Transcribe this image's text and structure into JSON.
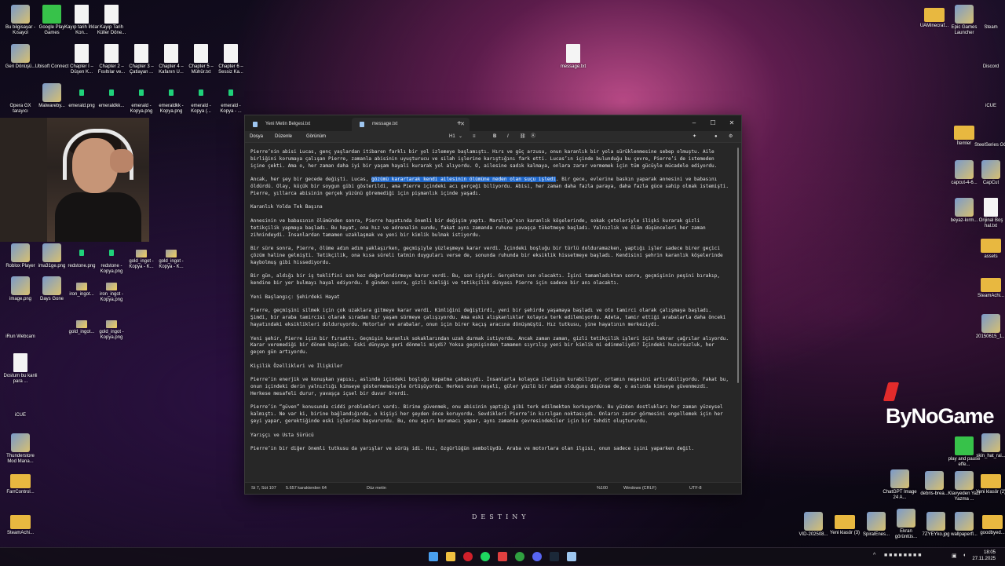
{
  "desktop": {
    "icons_left": [
      {
        "label": "Bu bilgisayar - Kısayol",
        "kind": "img"
      },
      {
        "label": "Google Play Games",
        "kind": "green"
      },
      {
        "label": "Kayıp tarih İrklar Kon...",
        "kind": "file"
      },
      {
        "label": "Kayıp Tarih Küller Döne...",
        "kind": "file"
      },
      {
        "label": "Geri Dönüşü...",
        "kind": "img"
      },
      {
        "label": "Ubisoft Connect",
        "kind": "round"
      },
      {
        "label": "Chapter I – Düşen K...",
        "kind": "file"
      },
      {
        "label": "Chapter 2 – Fısıltılar ve...",
        "kind": "file"
      },
      {
        "label": "Chapter 3 – Çatlayan ...",
        "kind": "file"
      },
      {
        "label": "Chapter 4 – Kafanın U...",
        "kind": "file"
      },
      {
        "label": "Chapter 5 – Mühür.txt",
        "kind": "file"
      },
      {
        "label": "Chapter 6 – Sessiz Ka...",
        "kind": "file"
      },
      {
        "label": "Opera GX tarayıcı",
        "kind": "round"
      },
      {
        "label": "Malwareby...",
        "kind": "img"
      },
      {
        "label": "emerald.png",
        "kind": "emerald"
      },
      {
        "label": "emeraldkk...",
        "kind": "emerald"
      },
      {
        "label": "emerald - Kopya.png",
        "kind": "emerald"
      },
      {
        "label": "emeraldkk - Kopya.png",
        "kind": "emerald"
      },
      {
        "label": "emerald - Kopya (...",
        "kind": "emerald"
      },
      {
        "label": "emerald - Kopya - ...",
        "kind": "emerald"
      },
      {
        "label": "Roblox Player",
        "kind": "img"
      },
      {
        "label": "ima31ge.png",
        "kind": "img"
      },
      {
        "label": "redstone.png",
        "kind": "emerald"
      },
      {
        "label": "redstone - Kopya.png",
        "kind": "emerald"
      },
      {
        "label": "gold_ingot - Kopya - K...",
        "kind": "gold"
      },
      {
        "label": "gold_ingot - Kopya - K...",
        "kind": "gold"
      },
      {
        "label": "image.png",
        "kind": "img"
      },
      {
        "label": "Days Gone",
        "kind": "img"
      },
      {
        "label": "iron_ingot...",
        "kind": "gold"
      },
      {
        "label": "iron_ingot - Kopya.png",
        "kind": "gold"
      },
      {
        "label": "iRun Webcam",
        "kind": "round"
      },
      {
        "label": "gold_ingot...",
        "kind": "gold"
      },
      {
        "label": "gold_ingot - Kopya.png",
        "kind": "gold"
      },
      {
        "label": "Dostum bu kanli para ...",
        "kind": "file"
      },
      {
        "label": "iCUE",
        "kind": "round"
      },
      {
        "label": "Thunderstore Mod Mana...",
        "kind": "img"
      },
      {
        "label": "FarrControl...",
        "kind": "folder"
      },
      {
        "label": "SteamAchi...",
        "kind": "folder"
      }
    ],
    "icons_right": [
      {
        "label": "UAMinecraf...",
        "kind": "folder"
      },
      {
        "label": "Epic Games Launcher",
        "kind": "img"
      },
      {
        "label": "Steam",
        "kind": "round"
      },
      {
        "label": "Discord",
        "kind": "round"
      },
      {
        "label": "iCUE",
        "kind": "round"
      },
      {
        "label": "İtemler",
        "kind": "folder"
      },
      {
        "label": "SteelSeries GG",
        "kind": "round"
      },
      {
        "label": "capcut-4-6...",
        "kind": "img"
      },
      {
        "label": "CapCut",
        "kind": "img"
      },
      {
        "label": "beyaz-kırm...",
        "kind": "img"
      },
      {
        "label": "Orijinal Boş hal.txt",
        "kind": "file"
      },
      {
        "label": "assets",
        "kind": "folder"
      },
      {
        "label": "SteamAchi...",
        "kind": "folder"
      },
      {
        "label": "20150615_1...",
        "kind": "img"
      },
      {
        "label": "play and pause effe...",
        "kind": "green"
      },
      {
        "label": "skin_hat_rai...",
        "kind": "img"
      },
      {
        "label": "ChatGPT Image 24 A...",
        "kind": "img"
      },
      {
        "label": "debris-brea...",
        "kind": "img"
      },
      {
        "label": "Klavyeden Yazı Yazma ...",
        "kind": "img"
      },
      {
        "label": "Yeni klasör (2)",
        "kind": "folder"
      },
      {
        "label": "VID-202508...",
        "kind": "img"
      },
      {
        "label": "Yeni klasör (3)",
        "kind": "folder"
      },
      {
        "label": "SpiralEnes...",
        "kind": "img"
      },
      {
        "label": "Ekran görüntüs...",
        "kind": "img"
      },
      {
        "label": "7ZYEYko.jpg",
        "kind": "img"
      },
      {
        "label": "wallpaperfl...",
        "kind": "img"
      },
      {
        "label": "goodbyed...",
        "kind": "folder"
      }
    ],
    "message_icon": {
      "label": "message.txt"
    },
    "brand": "ByNoGame",
    "wallpaper_text": "DESTINY"
  },
  "editor": {
    "tabs": [
      {
        "label": "Yeni Metin Belgesi.txt",
        "active": false
      },
      {
        "label": "message.txt",
        "active": true
      }
    ],
    "menus": [
      "Dosya",
      "Düzenle",
      "Görünüm"
    ],
    "heading_selector": "H1",
    "paragraphs": [
      "Pierre’nin abisi Lucas, genç yaşlardan itibaren farklı bir yol izlemeye başlamıştı. Hırs ve güç arzusu, onun karanlık bir yola sürüklenmesine sebep olmuştu. Aile birliğini korumaya çalışan Pierre, zamanla abisinin uyuşturucu ve silah işlerine karıştığını fark etti. Lucas’ın içinde bulunduğu bu çevre, Pierre’i de istemeden içine çekti. Ama o, her zaman daha iyi bir yaşam hayali kurarak yol alıyordu. O, ailesine sadık kalmaya, onlara zarar vermemek için tüm gücüyle mücadele ediyordu.",
      "Karanlık Yolda Tek Başına",
      "Annesinin ve babasının ölümünden sonra, Pierre hayatında önemli bir değişim yaptı. Marsilya’nın karanlık köşelerinde, sokak çeteleriyle ilişki kurarak gizli tetikçilik yapmaya başladı. Bu hayat, ona hız ve adrenalin sundu, fakat aynı zamanda ruhunu yavaşça tüketmeye başladı. Yalnızlık ve ölüm düşünceleri her zaman zihnindeydi. İnsanlardan tamamen uzaklaşmak ve yeni bir kimlik bulmak istiyordu.",
      "Bir süre sonra, Pierre, ölüme adım adım yaklaşırken, geçmişiyle yüzleşmeye karar verdi. İçindeki boşluğu bir türlü dolduramazken, yaptığı işler sadece birer geçici çözüm haline gelmişti. Tetikçilik, ona kısa süreli tatmin duyguları verse de, sonunda ruhunda bir eksiklik hissetmeye başladı. Kendisini şehrin karanlık köşelerinde kaybolmuş gibi hissediyordu.",
      "Bir gün, aldığı bir iş teklifini son kez değerlendirmeye karar verdi. Bu, son işiydi. Gerçekten son olacaktı. İşini tamamladıktan sonra, geçmişinin peşini bırakıp, kendine bir yer bulmayı hayal ediyordu. O günden sonra, gizli kimliği ve tetikçilik dünyası Pierre için sadece bir anı olacaktı.",
      " Yeni Başlangıç: Şehirdeki Hayat",
      "Pierre, geçmişini silmek için çok uzaklara gitmeye karar verdi. Kimliğini değiştirdi, yeni bir şehirde yaşamaya başladı ve oto tamirci olarak çalışmaya başladı. Şimdi, bir araba tamircisi olarak sıradan bir yaşam sürmeye çalışıyordu. Ama eski alışkanlıklar kolayca terk edilemiyordu. Adeta, tamir ettiği arabalarla daha önceki hayatındaki eksiklikleri dolduruyordu. Motorlar ve arabalar, onun için birer kaçış aracına dönüşmüştü. Hız tutkusu, yine hayatının merkeziydi.",
      "Yeni şehir, Pierre için bir fırsattı. Geçmişin karanlık sokaklarından uzak durmak istiyordu. Ancak zaman zaman, gizli tetikçilik işleri için tekrar çağrılar alıyordu. Karar veremediği bir dönem başladı. Eski dünyaya geri dönmeli miydi? Yoksa geçmişinden tamamen sıyrılıp yeni bir kimlik mi edinmeliydi? İçindeki huzursuzluk, her geçen gün artıyordu.",
      " Kişilik Özellikleri ve İlişkiler",
      "Pierre’in enerjik ve konuşkan yapısı, aslında içindeki boşluğu kapatma çabasıydı. İnsanlarla kolayca iletişim kurabiliyor, ortamın neşesini artırabiliyordu. Fakat bu, onun içindeki derin yalnızlığı kimseye göstermemesiyle örtüşüyordu. Herkes onun neşeli, güler yüzlü bir adam olduğunu düşünse de, o aslında kimseye güvenmezdi. Herkese mesafeli durur, yavaşça içsel bir duvar örerdi.",
      "Pierre’in “güven” konusunda ciddi problemleri vardı. Birine güvenmek, onu abisinin yaptığı gibi terk edilmekten korkuyordu. Bu yüzden dostlukları her zaman yüzeysel kalmıştı. Ne var ki, birine bağlandığında, o kişiyi her şeyden önce koruyordu. Sevdikleri Pierre’in kırılgan noktasıydı. Onların zarar görmesini engellemek için her şeyi yapar, gerektiğinde eski işlerine başvururdu. Bu, onu aşırı korumacı yapar, aynı zamanda çevresindekiler için bir tehdit oluştururdu.",
      " Yarışçı ve Usta Sürücü",
      "Pierre’in bir diğer önemli tutkusu da yarışlar ve sürüş idi. Hız, özgürlüğün sembolüydü. Araba ve motorlara olan ilgisi, onun sadece işini yaparken değil."
    ],
    "para2": {
      "before": "Ancak, her şey bir gecede değişti. Lucas, ",
      "selected": "gözümü karartarak kendi ailesinin ölümüne neden olan suçu işledi",
      "after": ". Bir gece, evlerine baskın yaparak annesini ve babasını öldürdü. Olay, küçük bir soygun gibi gösterildi, ama Pierre içindeki acı gerçeği biliyordu. Abisi, her zaman daha fazla paraya, daha fazla güce sahip olmak istemişti. Pierre, yıllarca abisinin gerçek yüzünü göremediği için pişmanlık içinde yaşadı."
    },
    "status": {
      "position": "St 7, Süt 107",
      "selection": "5.657 karakterden 64",
      "mode": "Düz metin",
      "zoom": "%100",
      "line_endings": "Windows (CRLF)",
      "encoding": "UTF-8"
    }
  },
  "taskbar": {
    "time": "18:05",
    "date": "27.11.2025"
  }
}
